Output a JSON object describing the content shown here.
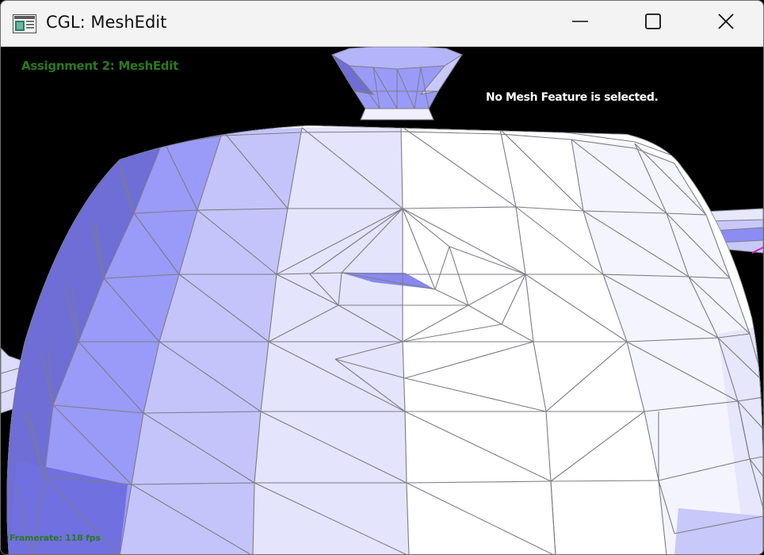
{
  "window": {
    "title": "CGL: MeshEdit",
    "app_icon": "application-icon",
    "controls": {
      "minimize_icon": "minimize-icon",
      "maximize_icon": "maximize-icon",
      "close_icon": "close-icon"
    }
  },
  "hud": {
    "assignment_title": "Assignment 2: MeshEdit",
    "selection_status": "No Mesh Feature is selected.",
    "framerate": "Framerate: 118 fps"
  },
  "viewport": {
    "background_color": "#000000",
    "mesh_colors": {
      "light": "#ffffff",
      "lavender": "#e4e4fc",
      "periwinkle": "#c4c4fa",
      "blue": "#9a9af8",
      "dark_blue": "#6e6ed6",
      "edge": "#7c7c88"
    },
    "hud_color": "#2a7a1e"
  }
}
